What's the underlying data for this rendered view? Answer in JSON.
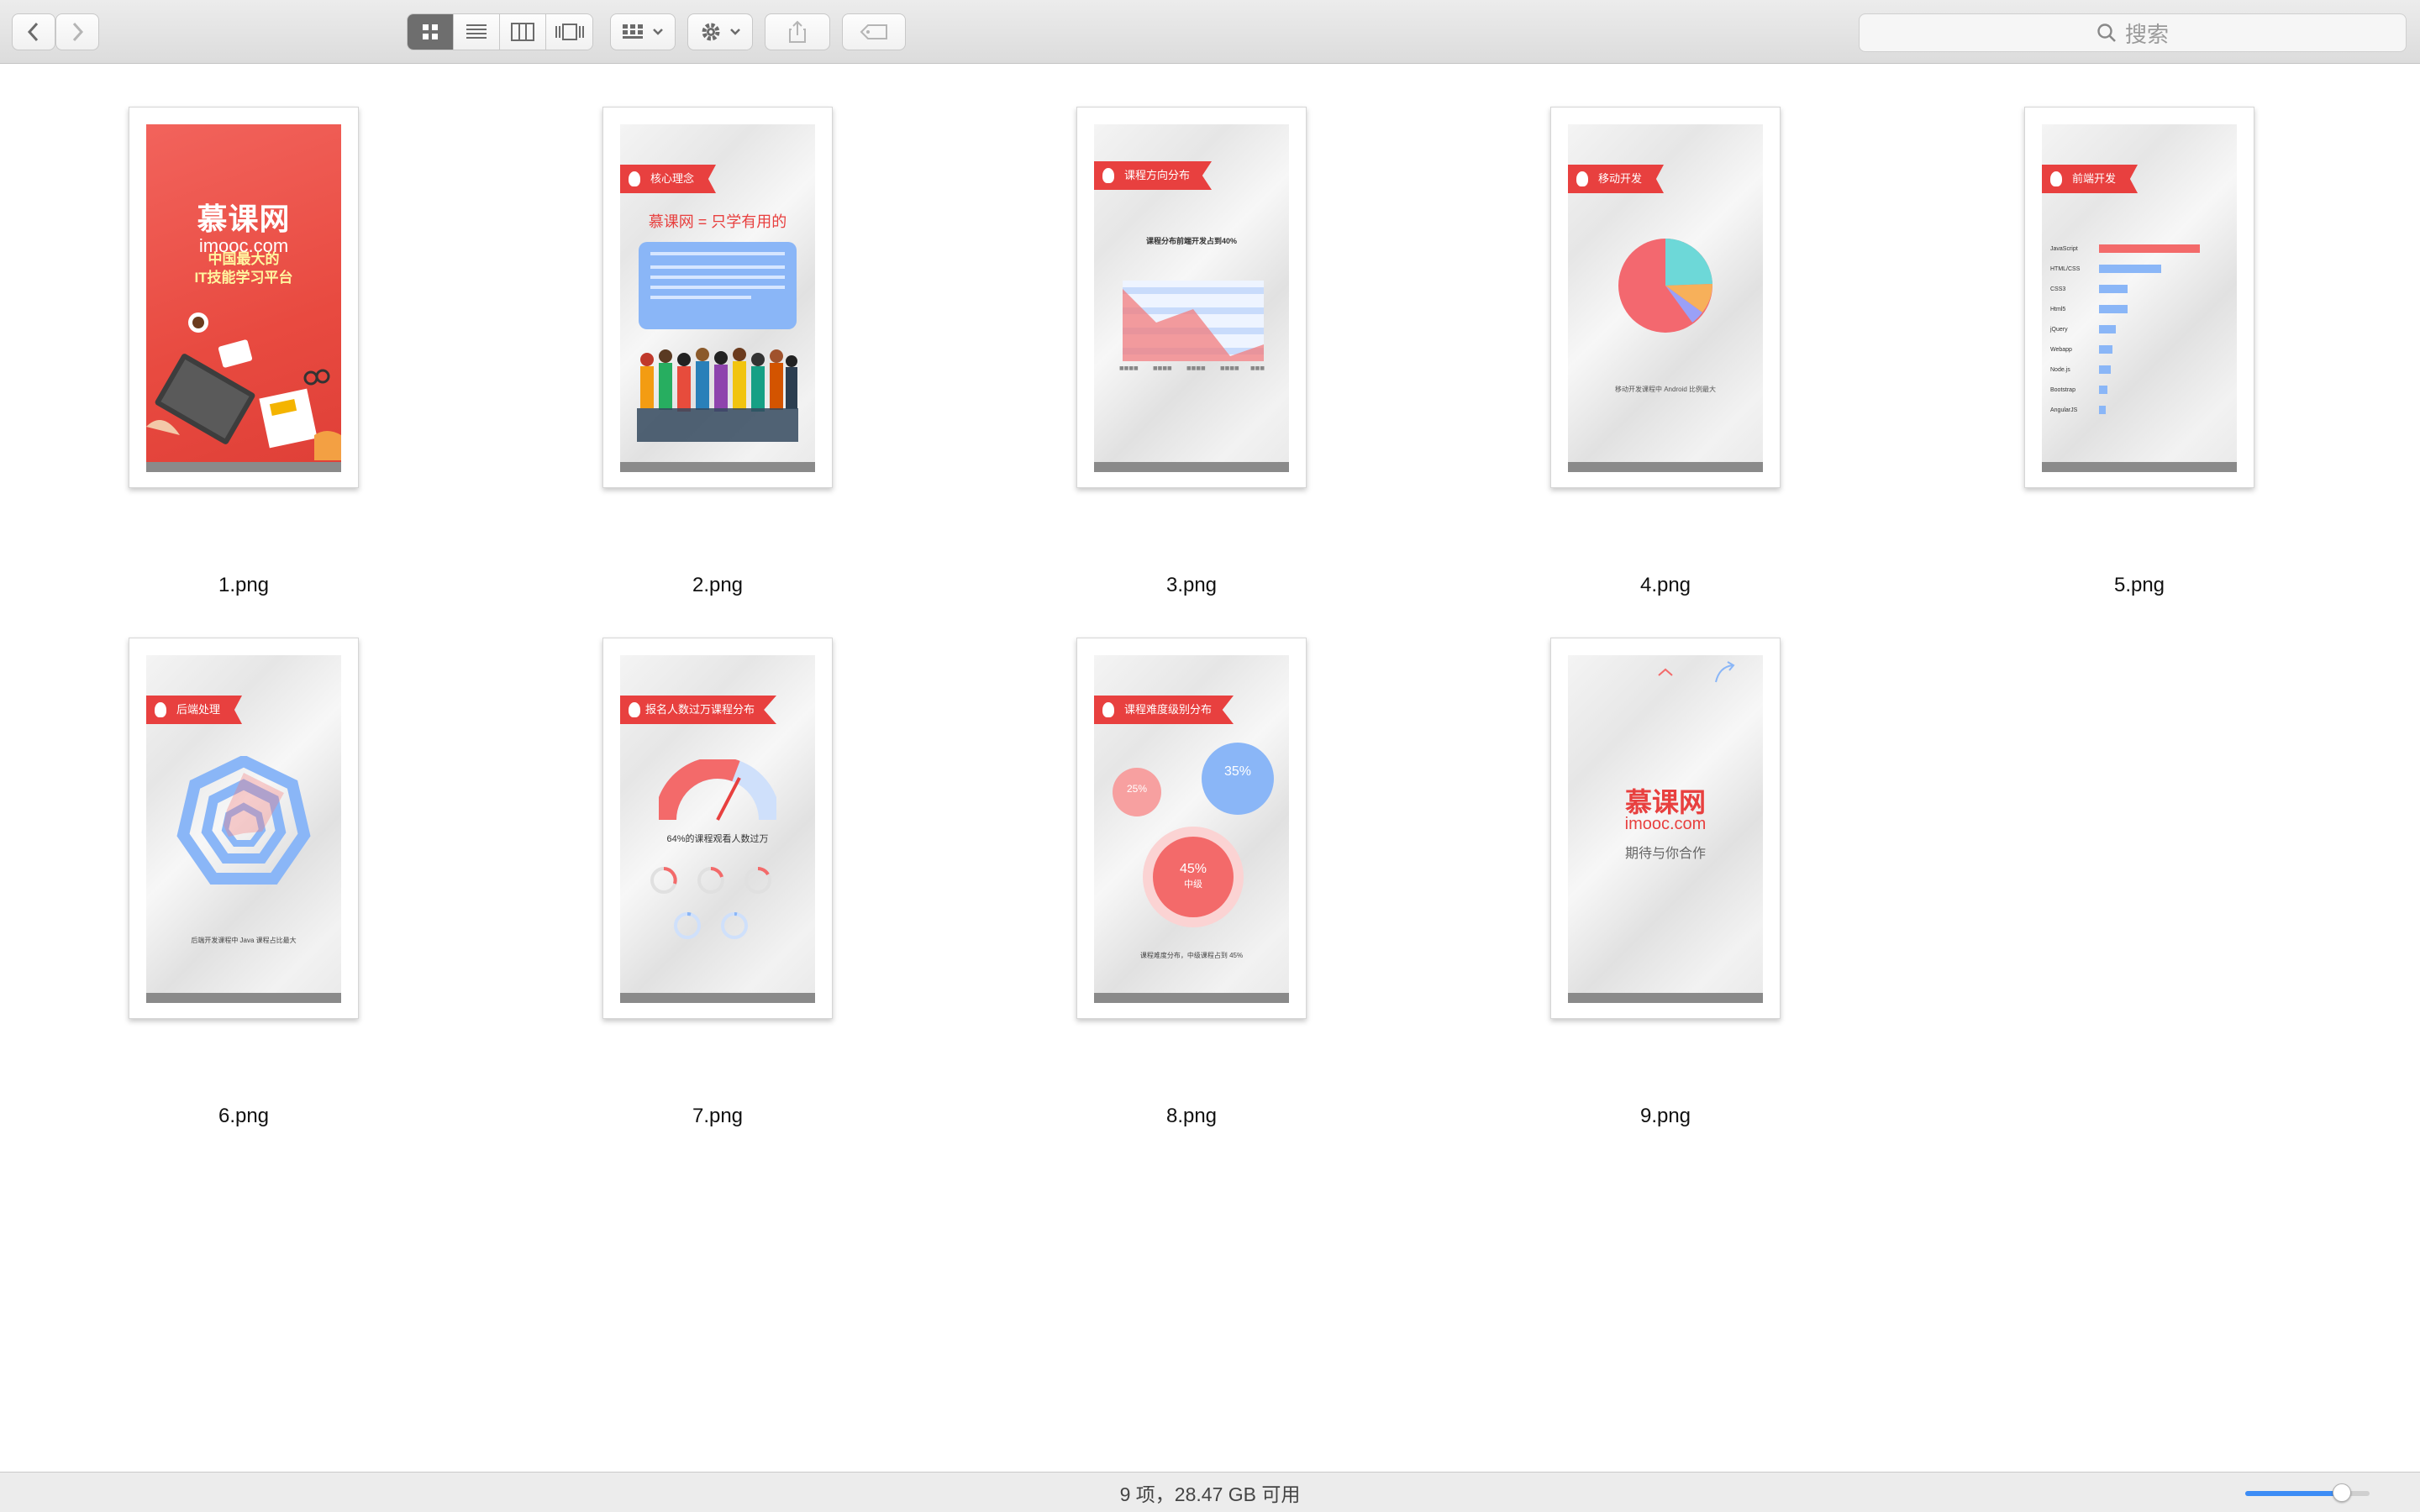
{
  "toolbar": {
    "search_placeholder": "搜索"
  },
  "files": [
    {
      "name": "1.png"
    },
    {
      "name": "2.png"
    },
    {
      "name": "3.png"
    },
    {
      "name": "4.png"
    },
    {
      "name": "5.png"
    },
    {
      "name": "6.png"
    },
    {
      "name": "7.png"
    },
    {
      "name": "8.png"
    },
    {
      "name": "9.png"
    }
  ],
  "slides": {
    "s1": {
      "brand": "慕课网",
      "domain": "imooc.com",
      "line1": "中国最大的",
      "line2": "IT技能学习平台"
    },
    "s2": {
      "title": "核心理念",
      "headline_a": "慕课网",
      "headline_b": "只学有用的"
    },
    "s3": {
      "title": "课程方向分布",
      "caption": "课程分布前端开发占到40%"
    },
    "s4": {
      "title": "移动开发",
      "caption": "移动开发课程中 Android 比例最大"
    },
    "s5": {
      "title": "前端开发",
      "labels": [
        "JavaScript",
        "HTML/CSS",
        "CSS3",
        "Html5",
        "jQuery",
        "Webapp",
        "Node.js",
        "Bootstrap",
        "AngularJS"
      ]
    },
    "s6": {
      "title": "后端处理",
      "caption": "后端开发课程中 Java 课程占比最大"
    },
    "s7": {
      "title": "报名人数过万课程分布",
      "caption": "64%的课程观看人数过万"
    },
    "s8": {
      "title": "课程难度级别分布",
      "b1": "35%",
      "b2": "25%",
      "b3": "45%",
      "b3sub": "中级",
      "caption": "课程难度分布，中级课程占到 45%"
    },
    "s9": {
      "brand": "慕课网",
      "domain": "imooc.com",
      "tagline": "期待与你合作"
    }
  },
  "status": {
    "summary": "9 项，28.47 GB 可用",
    "zoom_fraction": 0.78
  },
  "colors": {
    "accent_red": "#e8403f",
    "accent_blue": "#3c8cf5"
  }
}
